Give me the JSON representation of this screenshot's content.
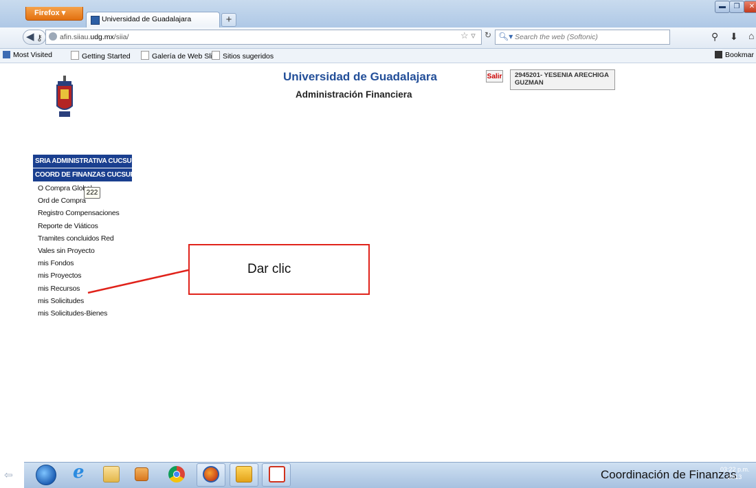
{
  "browser": {
    "menu_button": "Firefox ▾",
    "tab_title": "Universidad de Guadalajara",
    "new_tab": "+",
    "url_prefix": "afin.siiau.",
    "url_domain": "udg.mx",
    "url_suffix": "/siia/",
    "search_placeholder": "Search the web (Softonic)",
    "bookmarks": [
      "Most Visited",
      "Getting Started",
      "Galería de Web Slice",
      "Sitios sugeridos"
    ],
    "bookmarks_menu": "Bookmar"
  },
  "page": {
    "title": "Universidad de Guadalajara",
    "subtitle": "Administración Financiera",
    "logout_label": "Salir",
    "user_line1": "2945201- YESENIA ARECHIGA",
    "user_line2": "GUZMAN",
    "menu_heads": [
      "SRIA ADMINISTRATIVA CUCSUR",
      "COORD DE FINANZAS CUCSUR"
    ],
    "menu_items": [
      "O Compra Global",
      "Ord de Compra",
      "Registro Compensaciones",
      "Reporte de Viáticos",
      "Tramites concluidos Red",
      "Vales sin Proyecto",
      "mis Fondos",
      "mis Proyectos",
      "mis Recursos",
      "mis Solicitudes",
      "mis Solicitudes-Bienes"
    ],
    "tooltip": "222"
  },
  "annotation": {
    "callout": "Dar clic",
    "color": "#e0221a"
  },
  "taskbar": {
    "time": "03:22 p.m.",
    "date": "2013",
    "footer": "Coordinación de Finanzas"
  }
}
